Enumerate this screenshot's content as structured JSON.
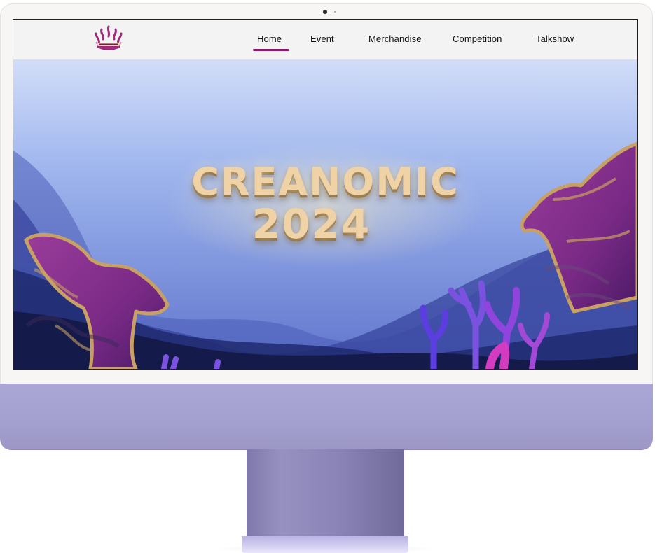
{
  "nav": {
    "logo_icon": "creanomic-crown-logo-icon",
    "items": [
      {
        "label": "Home",
        "active": true
      },
      {
        "label": "Event",
        "active": false
      },
      {
        "label": "Merchandise",
        "active": false
      },
      {
        "label": "Competition",
        "active": false
      },
      {
        "label": "Talkshow",
        "active": false
      }
    ],
    "active_color": "#8c1a6a"
  },
  "hero": {
    "title_line_1": "CREANOMIC",
    "title_line_2": "2024",
    "title_color": "#efd3a6",
    "sky_top_color": "#cfdcf8",
    "sky_bottom_color": "#6f86d6",
    "coral_color": "#7a2a86",
    "coral_outline_color": "#c9a063",
    "reef_colors": [
      "#5b3de0",
      "#8f45dd",
      "#d33bc0"
    ]
  },
  "device": {
    "chin_color": "#a8a4d4",
    "stand_color": "#8a84b6"
  }
}
